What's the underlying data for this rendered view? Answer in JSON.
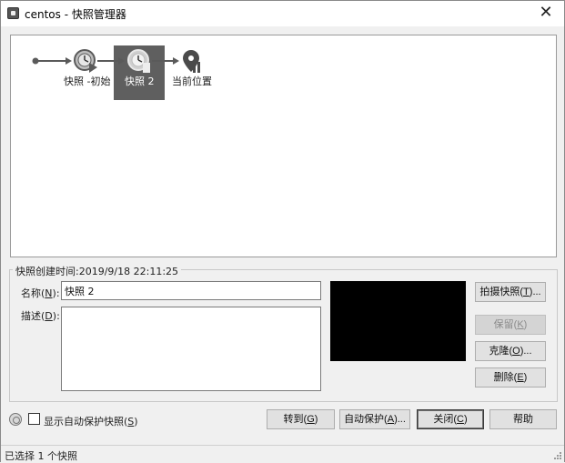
{
  "window": {
    "title": "centos - 快照管理器"
  },
  "tree": {
    "nodes": [
      {
        "label": "快照 -初始"
      },
      {
        "label": "快照 2",
        "selected": true
      },
      {
        "label": "当前位置"
      }
    ]
  },
  "details": {
    "created_label": "快照创建时间:",
    "created_value": "2019/9/18 22:11:25",
    "name_label": "名称(",
    "name_key": "N",
    "name_label_end": "):",
    "name_value": "快照 2",
    "desc_label": "描述(",
    "desc_key": "D",
    "desc_label_end": "):",
    "desc_value": ""
  },
  "side_buttons": {
    "take_snapshot": {
      "text": "拍摄快照(",
      "key": "T",
      "end": ")..."
    },
    "keep": {
      "text": "保留(",
      "key": "K",
      "end": ")"
    },
    "clone": {
      "text": "克隆(",
      "key": "O",
      "end": ")..."
    },
    "delete": {
      "text": "删除(",
      "key": "E",
      "end": ")"
    }
  },
  "bottom": {
    "show_autoprotect": {
      "text": "显示自动保护快照(",
      "key": "S",
      "end": ")",
      "checked": false
    },
    "goto": {
      "text": "转到(",
      "key": "G",
      "end": ")"
    },
    "autoprotect": {
      "text": "自动保护(",
      "key": "A",
      "end": ")..."
    },
    "close": {
      "text": "关闭(",
      "key": "C",
      "end": ")"
    },
    "help": "帮助"
  },
  "status": {
    "text": "已选择 1 个快照"
  },
  "icons": {
    "app": "vm-app-icon",
    "snapshot": "clock-snapshot-icon",
    "current": "location-pin-icon",
    "help": "help-circle-icon"
  }
}
